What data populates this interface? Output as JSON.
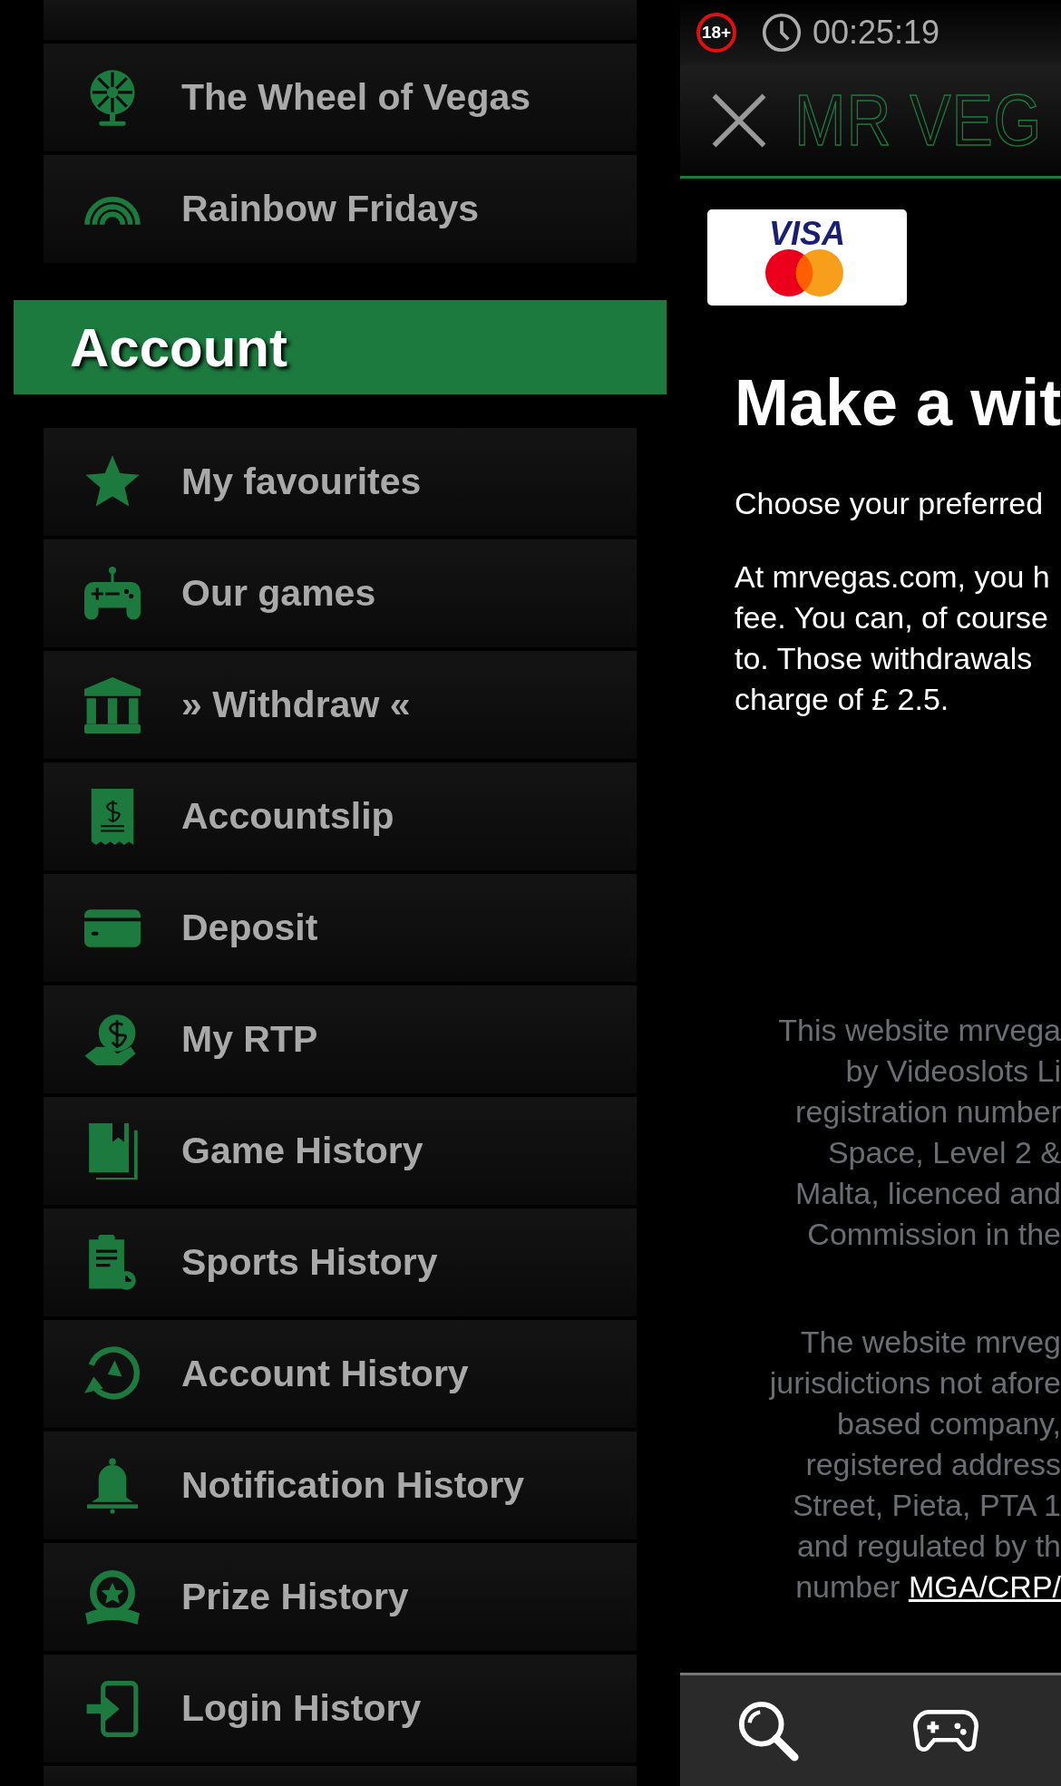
{
  "menu": {
    "top_items": [
      {
        "label": "The Wheel of Vegas"
      },
      {
        "label": "Rainbow Fridays"
      }
    ],
    "section_title": "Account",
    "items": [
      {
        "label": "My favourites"
      },
      {
        "label": "Our games"
      },
      {
        "label": "» Withdraw «"
      },
      {
        "label": "Accountslip"
      },
      {
        "label": "Deposit"
      },
      {
        "label": "My RTP"
      },
      {
        "label": "Game History"
      },
      {
        "label": "Sports History"
      },
      {
        "label": "Account History"
      },
      {
        "label": "Notification History"
      },
      {
        "label": "Prize History"
      },
      {
        "label": "Login History"
      }
    ]
  },
  "status_bar": {
    "age_badge": "18+",
    "timer": "00:25:19"
  },
  "header": {
    "logo": "MR VEG"
  },
  "content": {
    "card_brand": "VISA",
    "title": "Make a wit",
    "paragraphs": [
      [
        "Choose your preferred"
      ],
      [
        "At mrvegas.com, you h",
        "fee. You can, of course",
        "to. Those withdrawals",
        "charge of £ 2.5."
      ]
    ]
  },
  "footer": {
    "paragraphs": [
      {
        "lines": [
          "This website mrvega",
          "by Videoslots Li",
          "registration number",
          "Space, Level 2 &",
          "Malta, licenced and",
          "Commission in the"
        ]
      },
      {
        "lines": [
          "The website mrveg",
          "jurisdictions not afore",
          "based company,",
          "registered address",
          "Street, Pieta, PTA 1",
          "and regulated by th",
          "number "
        ],
        "link": "MGA/CRP/"
      }
    ]
  }
}
